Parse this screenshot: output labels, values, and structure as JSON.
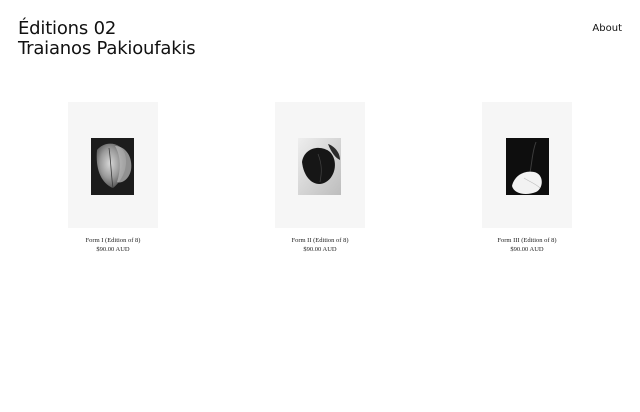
{
  "header": {
    "title_line1": "Éditions 02",
    "title_line2": "Traianos Pakioufakis",
    "nav_about": "About"
  },
  "products": [
    {
      "name": "Form I (Edition of 8)",
      "price": "$90.00 AUD"
    },
    {
      "name": "Form II (Edition of 8)",
      "price": "$90.00 AUD"
    },
    {
      "name": "Form III (Edition of 8)",
      "price": "$90.00 AUD"
    }
  ],
  "colors": {
    "background": "#ffffff",
    "frame": "#f6f6f6",
    "text": "#111111"
  }
}
